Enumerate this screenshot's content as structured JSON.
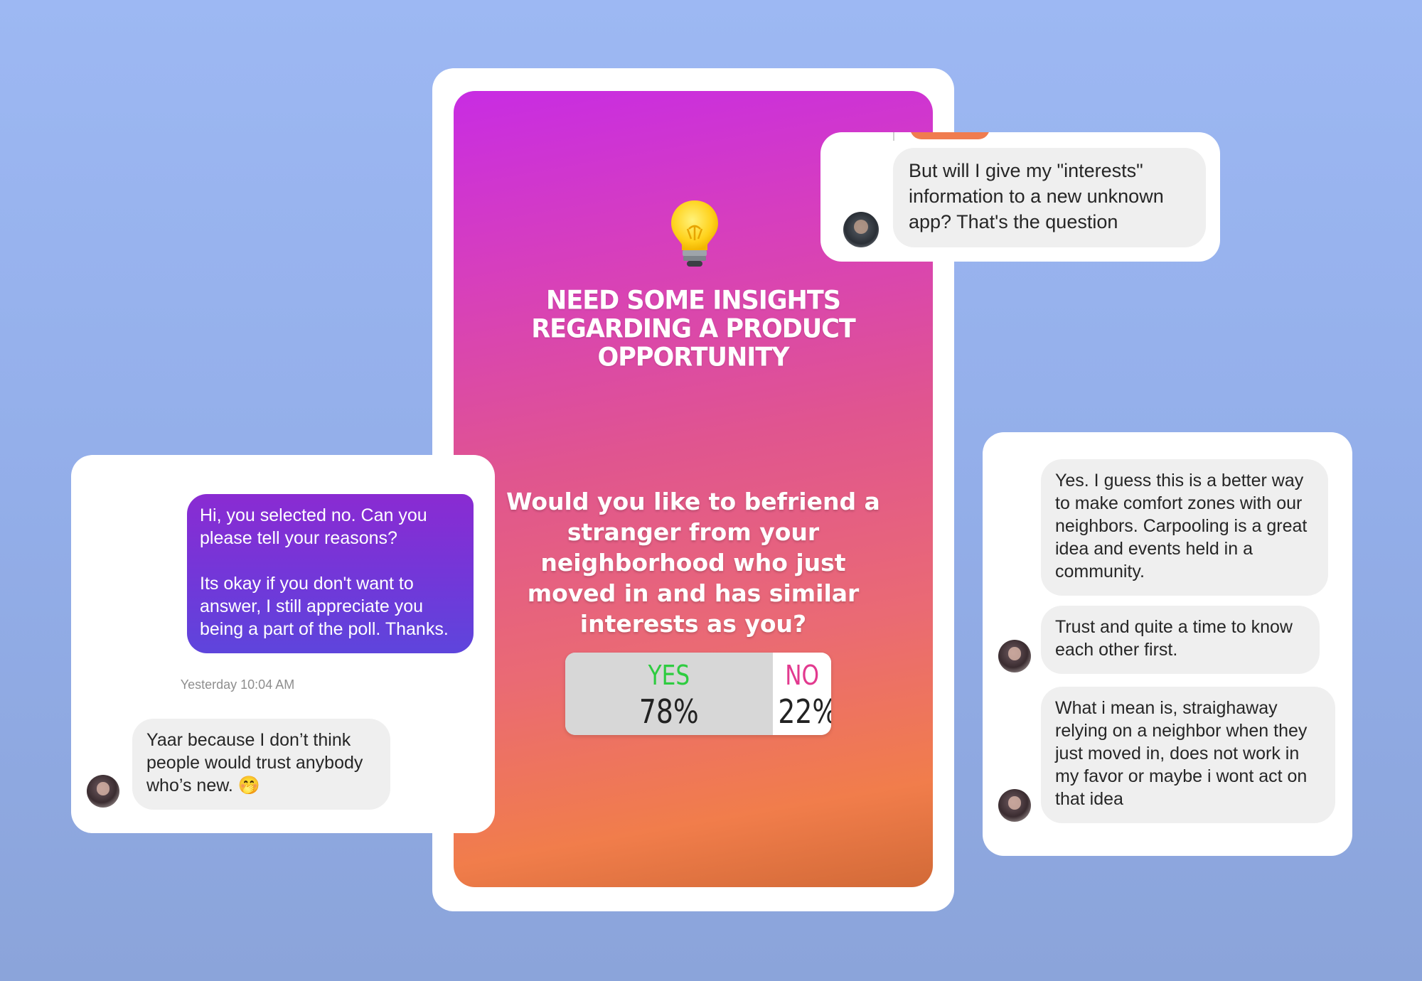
{
  "story": {
    "title": "Need some insights regarding a product opportunity",
    "question": "Would you like to befriend a stranger from your neighborhood who just moved in and has similar interests as you?",
    "poll": {
      "yes_label": "YES",
      "yes_percent": "78%",
      "no_label": "NO",
      "no_percent": "22%",
      "yes_fraction": 0.78,
      "yes_color": "#2ecc40",
      "no_color": "#e23a8f"
    }
  },
  "chat_left": {
    "sent_message": "Hi, you selected no. Can you please tell your reasons?\n\nIts okay if you don't want to answer, I still appreciate you being a part of the poll. Thanks.",
    "timestamp": "Yesterday 10:04 AM",
    "reply": "Yaar because I don’t think people would trust anybody who’s new. 🤭"
  },
  "chat_top_right": {
    "reply": "But will I give my \"interests\" information to a new unknown app? That's the question"
  },
  "chat_right": {
    "messages": [
      "Yes. I guess this is a better way to make comfort zones with our neighbors. Carpooling is a great idea and events held in a community.",
      "Trust and quite a time to know each other first.",
      "What i mean is, straighaway relying on a neighbor when they just moved in, does not work in my favor or maybe i wont act on that idea"
    ]
  }
}
